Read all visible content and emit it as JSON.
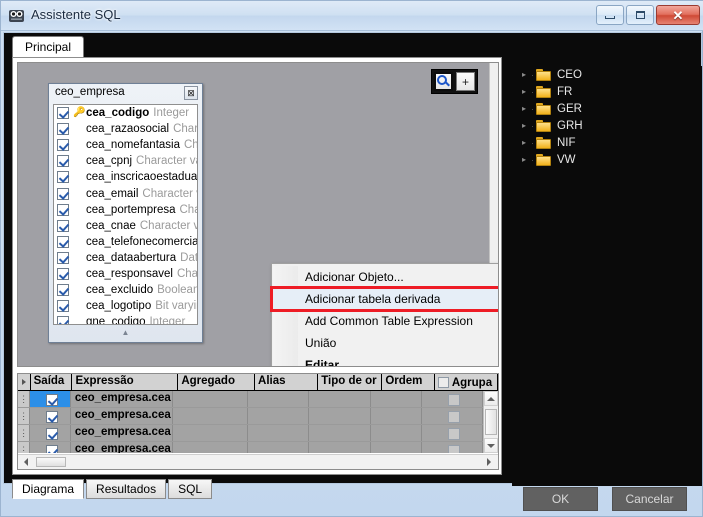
{
  "window": {
    "title": "Assistente SQL",
    "icon": "app-icon",
    "minimize_label": "",
    "maximize_label": "",
    "close_label": "✕"
  },
  "tabs": {
    "main_tab": "Principal"
  },
  "toolbar": {
    "zoom_search_icon": "magnifier-icon",
    "zoom_in_label": "+"
  },
  "table_widget": {
    "title": "ceo_empresa",
    "close_label": "⊠",
    "scroll_hint": "▲",
    "fields": [
      {
        "name": "cea_codigo",
        "type": "Integer",
        "pk": true,
        "checked": true
      },
      {
        "name": "cea_razaosocial",
        "type": "Charact",
        "pk": false,
        "checked": true
      },
      {
        "name": "cea_nomefantasia",
        "type": "Char",
        "pk": false,
        "checked": true
      },
      {
        "name": "cea_cpnj",
        "type": "Character var",
        "pk": false,
        "checked": true
      },
      {
        "name": "cea_inscricaoestadual",
        "type": "(",
        "pk": false,
        "checked": true
      },
      {
        "name": "cea_email",
        "type": "Character va",
        "pk": false,
        "checked": true
      },
      {
        "name": "cea_portempresa",
        "type": "Chara",
        "pk": false,
        "checked": true
      },
      {
        "name": "cea_cnae",
        "type": "Character va",
        "pk": false,
        "checked": true
      },
      {
        "name": "cea_telefonecomercial",
        "type": "",
        "pk": false,
        "checked": true
      },
      {
        "name": "cea_dataabertura",
        "type": "Date",
        "pk": false,
        "checked": true
      },
      {
        "name": "cea_responsavel",
        "type": "Chara",
        "pk": false,
        "checked": true
      },
      {
        "name": "cea_excluido",
        "type": "Boolean",
        "pk": false,
        "checked": true
      },
      {
        "name": "cea_logotipo",
        "type": "Bit varying",
        "pk": false,
        "checked": true
      },
      {
        "name": "gne_codigo",
        "type": "Integer",
        "pk": false,
        "checked": true
      }
    ]
  },
  "context_menu": {
    "highlight_color": "#ee1c25",
    "items": [
      {
        "label": "Adicionar Objeto...",
        "submenu": false,
        "highlighted": false,
        "bold": false
      },
      {
        "label": "Adicionar tabela derivada",
        "submenu": false,
        "highlighted": true,
        "bold": false
      },
      {
        "label": "Add Common Table Expression",
        "submenu": true,
        "highlighted": false,
        "bold": false
      },
      {
        "label": "União",
        "submenu": true,
        "highlighted": false,
        "bold": false
      },
      {
        "label": "Editar...",
        "submenu": false,
        "highlighted": false,
        "bold": true
      }
    ]
  },
  "grid": {
    "columns": [
      "Saída",
      "Expressão",
      "Agregado",
      "Alias",
      "Tipo de or",
      "Ordem",
      "Agrupa"
    ],
    "group_header_checkbox": false,
    "rows": [
      {
        "saida": true,
        "expressao": "ceo_empresa.cea",
        "agregado": "",
        "alias": "",
        "tipo": "",
        "ordem": "",
        "agrupar": false,
        "selected": true
      },
      {
        "saida": true,
        "expressao": "ceo_empresa.cea",
        "agregado": "",
        "alias": "",
        "tipo": "",
        "ordem": "",
        "agrupar": false,
        "selected": false
      },
      {
        "saida": true,
        "expressao": "ceo_empresa.cea",
        "agregado": "",
        "alias": "",
        "tipo": "",
        "ordem": "",
        "agrupar": false,
        "selected": false
      },
      {
        "saida": true,
        "expressao": "ceo_empresa.cea",
        "agregado": "",
        "alias": "",
        "tipo": "",
        "ordem": "",
        "agrupar": false,
        "selected": false
      }
    ]
  },
  "bottom_tabs": [
    {
      "label": "Diagrama",
      "active": true
    },
    {
      "label": "Resultados",
      "active": false
    },
    {
      "label": "SQL",
      "active": false
    }
  ],
  "tree": {
    "nodes": [
      {
        "label": "CEO",
        "icon": "folder-icon"
      },
      {
        "label": "FR",
        "icon": "folder-icon"
      },
      {
        "label": "GER",
        "icon": "folder-icon"
      },
      {
        "label": "GRH",
        "icon": "folder-icon"
      },
      {
        "label": "NIF",
        "icon": "folder-icon"
      },
      {
        "label": "VW",
        "icon": "folder-icon"
      }
    ]
  },
  "footer": {
    "ok_label": "OK",
    "cancel_label": "Cancelar"
  }
}
